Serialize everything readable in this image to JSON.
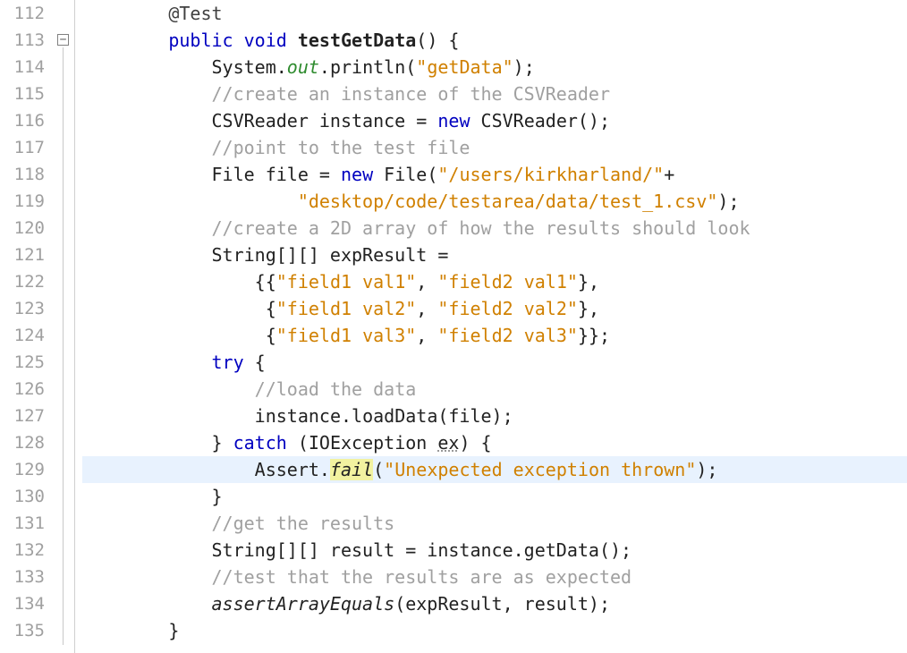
{
  "lines": {
    "start": 112,
    "end": 135,
    "numbers": [
      "112",
      "113",
      "114",
      "115",
      "116",
      "117",
      "118",
      "119",
      "120",
      "121",
      "122",
      "123",
      "124",
      "125",
      "126",
      "127",
      "128",
      "129",
      "130",
      "131",
      "132",
      "133",
      "134",
      "135"
    ]
  },
  "fold": {
    "minus_label": "−"
  },
  "code": {
    "l112": {
      "ann": "@Test"
    },
    "l113": {
      "kw1": "public",
      "kw2": "void",
      "name": "testGetData",
      "tail": "() {"
    },
    "l114": {
      "cls": "System.",
      "out": "out",
      "call": ".println(",
      "str": "\"getData\"",
      "end": ");"
    },
    "l115": {
      "cmt": "//create an instance of the CSVReader"
    },
    "l116": {
      "pre": "CSVReader instance = ",
      "kw": "new",
      "tail": " CSVReader();"
    },
    "l117": {
      "cmt": "//point to the test file"
    },
    "l118": {
      "pre": "File file = ",
      "kw": "new",
      "mid": " File(",
      "str": "\"/users/kirkharland/\"",
      "plus": "+"
    },
    "l119": {
      "str": "\"desktop/code/testarea/data/test_1.csv\"",
      "end": ");"
    },
    "l120": {
      "cmt": "//create a 2D array of how the results should look"
    },
    "l121": {
      "txt": "String[][] expResult ="
    },
    "l122": {
      "open": "{{",
      "s1": "\"field1 val1\"",
      "comma1": ", ",
      "s2": "\"field2 val1\"",
      "close": "},"
    },
    "l123": {
      "open": " {",
      "s1": "\"field1 val2\"",
      "comma1": ", ",
      "s2": "\"field2 val2\"",
      "close": "},"
    },
    "l124": {
      "open": " {",
      "s1": "\"field1 val3\"",
      "comma1": ", ",
      "s2": "\"field2 val3\"",
      "close": "}};"
    },
    "l125": {
      "kw": "try",
      "tail": " {"
    },
    "l126": {
      "cmt": "//load the data"
    },
    "l127": {
      "txt": "instance.loadData(file);"
    },
    "l128": {
      "close": "} ",
      "kw": "catch",
      "mid": " (IOException ",
      "ex": "ex",
      "tail": ") {"
    },
    "l129": {
      "pre": "Assert.",
      "fail": "fail",
      "open": "(",
      "str": "\"Unexpected exception thrown\"",
      "end": ");"
    },
    "l130": {
      "txt": "}"
    },
    "l131": {
      "cmt": "//get the results"
    },
    "l132": {
      "txt": "String[][] result = instance.getData();"
    },
    "l133": {
      "cmt": "//test that the results are as expected"
    },
    "l134": {
      "fn": "assertArrayEquals",
      "args": "(expResult, result);"
    },
    "l135": {
      "txt": "}"
    }
  }
}
